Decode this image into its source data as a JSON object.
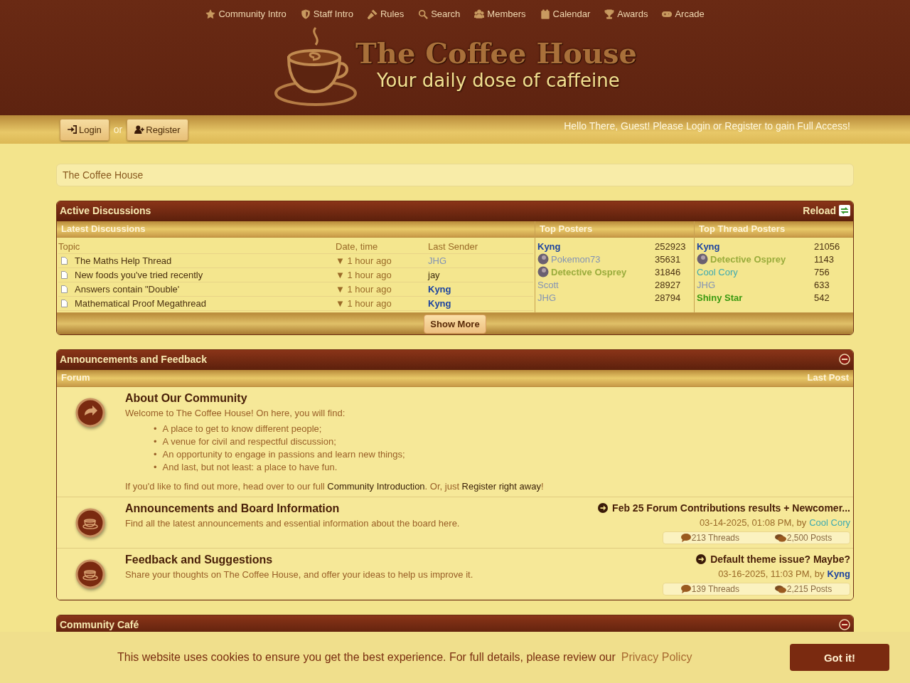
{
  "nav": [
    {
      "label": "Community Intro"
    },
    {
      "label": "Staff Intro"
    },
    {
      "label": "Rules"
    },
    {
      "label": "Search"
    },
    {
      "label": "Members"
    },
    {
      "label": "Calendar"
    },
    {
      "label": "Awards"
    },
    {
      "label": "Arcade"
    }
  ],
  "logo": {
    "title": "The Coffee House",
    "tagline": "Your daily dose of caffeine"
  },
  "userbar": {
    "login": "Login",
    "or": "or",
    "register": "Register",
    "greeting": "Hello There, Guest! Please Login or Register to gain Full Access!"
  },
  "breadcrumb": "The Coffee House",
  "active_discussions": {
    "title": "Active Discussions",
    "reload": "Reload",
    "latest": {
      "title": "Latest Discussions",
      "columns": [
        "Topic",
        "Date, time",
        "Last Sender"
      ],
      "rows": [
        {
          "topic": "The Maths Help Thread",
          "time": "▼ 1 hour ago",
          "sender": {
            "name": "JHG",
            "color": "#8393b5",
            "bold": false
          }
        },
        {
          "topic": "New foods you've tried recently",
          "time": "▼ 1 hour ago",
          "sender": {
            "name": "jay",
            "color": "#3d2b0e",
            "bold": false
          }
        },
        {
          "topic": "Answers contain \"Double'",
          "time": "▼ 1 hour ago",
          "sender": {
            "name": "Kyng",
            "color": "#1d44a0",
            "bold": true
          }
        },
        {
          "topic": "Mathematical Proof Megathread",
          "time": "▼ 1 hour ago",
          "sender": {
            "name": "Kyng",
            "color": "#1d44a0",
            "bold": true
          }
        }
      ]
    },
    "top_posters": {
      "title": "Top Posters",
      "rows": [
        {
          "name": "Kyng",
          "color": "#1d44a0",
          "bold": true,
          "avatar": false,
          "count": "252923"
        },
        {
          "name": "Pokemon73",
          "color": "#8393b5",
          "bold": false,
          "avatar": true,
          "count": "35631"
        },
        {
          "name": "Detective Osprey",
          "color": "#9aac3c",
          "bold": true,
          "avatar": true,
          "count": "31846"
        },
        {
          "name": "Scott",
          "color": "#8393b5",
          "bold": false,
          "avatar": false,
          "count": "28927"
        },
        {
          "name": "JHG",
          "color": "#8393b5",
          "bold": false,
          "avatar": false,
          "count": "28794"
        }
      ]
    },
    "top_thread_posters": {
      "title": "Top Thread Posters",
      "rows": [
        {
          "name": "Kyng",
          "color": "#1d44a0",
          "bold": true,
          "avatar": false,
          "count": "21056"
        },
        {
          "name": "Detective Osprey",
          "color": "#9aac3c",
          "bold": true,
          "avatar": true,
          "count": "1143"
        },
        {
          "name": "Cool Cory",
          "color": "#3eaab0",
          "bold": false,
          "avatar": false,
          "count": "756"
        },
        {
          "name": "JHG",
          "color": "#8393b5",
          "bold": false,
          "avatar": false,
          "count": "633"
        },
        {
          "name": "Shiny Star",
          "color": "#3a9a10",
          "bold": true,
          "avatar": false,
          "count": "542"
        }
      ]
    },
    "show_more": "Show More"
  },
  "categories": [
    {
      "title": "Announcements and Feedback",
      "expanded": true,
      "columns": [
        "Forum",
        "Last Post"
      ],
      "forums": [
        {
          "kind": "intro",
          "title": "About Our Community",
          "intro": "Welcome to The Coffee House! On here, you will find:",
          "bullets": [
            {
              "marker": "•",
              "text": "A place to get to know different people;"
            },
            {
              "marker": "•",
              "text": "A venue for civil and respectful discussion;"
            },
            {
              "marker": "•",
              "text": "An opportunity to engage in passions and learn new things;"
            },
            {
              "marker": "•",
              "text": "And last, but not least: a place to have fun."
            }
          ],
          "outro": [
            {
              "text": "If you'd like to find out more, head over to our full "
            },
            {
              "text": "Community Introduction",
              "link": true
            },
            {
              "text": ". Or, just "
            },
            {
              "text": "Register right away",
              "link": true
            },
            {
              "text": "!"
            }
          ]
        },
        {
          "kind": "forum",
          "title": "Announcements and Board Information",
          "description": "Find all the latest announcements and essential information about the board here.",
          "last_post": {
            "title": "Feb 25 Forum Contributions results + Newcomer...",
            "date": "03-14-2025, 01:08 PM, by",
            "author": {
              "name": "Cool Cory",
              "color": "#3eaab0",
              "bold": false
            }
          },
          "threads": "213 Threads",
          "posts": "2,500 Posts"
        },
        {
          "kind": "forum",
          "title": "Feedback and Suggestions",
          "description": "Share your thoughts on The Coffee House, and offer your ideas to help us improve it.",
          "last_post": {
            "title": "Default theme issue? Maybe?",
            "date": "03-16-2025, 11:03 PM, by",
            "author": {
              "name": "Kyng",
              "color": "#1d44a0",
              "bold": true
            }
          },
          "threads": "139 Threads",
          "posts": "2,215 Posts"
        }
      ]
    },
    {
      "title": "Community Café",
      "expanded": true
    }
  ],
  "cookie": {
    "message": "This website uses cookies to ensure you get the best experience. For full details, please review our",
    "link": "Privacy Policy",
    "button": "Got it!"
  }
}
